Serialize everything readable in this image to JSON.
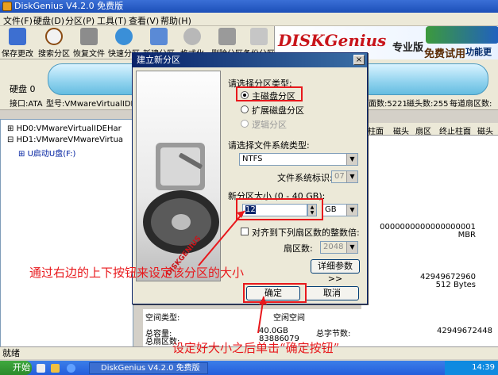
{
  "window": {
    "title": "DiskGenius V4.2.0 免费版"
  },
  "menu": [
    "文件(F)",
    "硬盘(D)",
    "分区(P)",
    "工具(T)",
    "查看(V)",
    "帮助(H)"
  ],
  "toolbar": [
    "保存更改",
    "搜索分区",
    "恢复文件",
    "快速分区",
    "新建分区",
    "格式化",
    "删除分区",
    "备份分区"
  ],
  "banner": {
    "logo": "DISKGenius",
    "tagline": "专业版",
    "promo": "免费试用",
    "promo2": "功能更"
  },
  "disk_panel": {
    "label": "硬盘 0"
  },
  "info_bar": {
    "interface": "接口:ATA",
    "model": "型号:VMwareVirtualIDEHar",
    "cylinders": "面数:5221",
    "heads": "磁头数:255",
    "sectors": "每道扇区数:"
  },
  "tree": {
    "hd0": "HD0:VMwareVirtualIDEHar",
    "hd1": "HD1:VMwareVMwareVirtua",
    "usb": "U启动U盘(F:)"
  },
  "grid_headers": [
    "柱面",
    "磁头",
    "扇区",
    "终止柱面",
    "磁头"
  ],
  "right_values": {
    "serial": "0000000000000000001",
    "partition_table": "MBR",
    "total_bytes_a": "42949672960",
    "sector_size": "512 Bytes",
    "total_bytes_b": "42949672448"
  },
  "lower_panel": {
    "space_type_label": "空间类型:",
    "space_type_value": "空闲空间",
    "total_capacity_label": "总容量:",
    "total_capacity_value": "40.0GB",
    "total_sectors_label": "总扇区数:",
    "total_sectors_value": "83886079",
    "total_bytes_label": "总字节数:"
  },
  "status": "就绪",
  "taskbar": {
    "start": "开始",
    "app": "DiskGenius V4.2.0 免费版",
    "clock": "14:39"
  },
  "dialog": {
    "title": "建立新分区",
    "close": "×",
    "type_label": "请选择分区类型:",
    "type_options": [
      {
        "label": "主磁盘分区",
        "selected": true,
        "enabled": true
      },
      {
        "label": "扩展磁盘分区",
        "selected": false,
        "enabled": true
      },
      {
        "label": "逻辑分区",
        "selected": false,
        "enabled": false
      }
    ],
    "fs_label": "请选择文件系统类型:",
    "fs_value": "NTFS",
    "fs_id_label": "文件系统标识:",
    "fs_id_value": "07",
    "size_label": "新分区大小 (0 - 40 GB):",
    "size_value": "12",
    "size_unit": "GB",
    "align_label": "对齐到下列扇区数的整数倍:",
    "sector_count_label": "扇区数:",
    "sector_count_value": "2048",
    "advanced_button": "详细参数>>",
    "ok_button": "确定",
    "cancel_button": "取消",
    "image_text": "DISKGENIUS"
  },
  "annotations": {
    "a1": "通过右边的上下按钮来设定该分区的大小",
    "a2": "设定好大小之后单击“确定按钮”"
  }
}
